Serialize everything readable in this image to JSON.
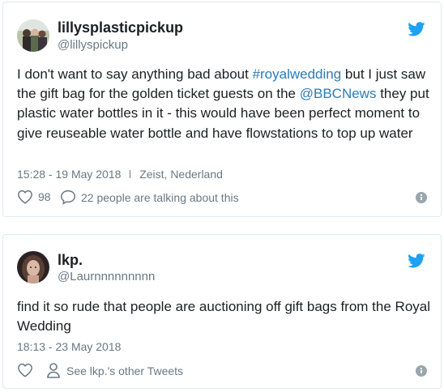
{
  "tweets": [
    {
      "display_name": "lillysplasticpickup",
      "handle": "@lillyspickup",
      "text_parts": [
        {
          "t": "I  don't want to say anything bad about ",
          "link": false
        },
        {
          "t": "#royalwedding",
          "link": true
        },
        {
          "t": " but I just saw the gift bag for the golden ticket guests on the ",
          "link": false
        },
        {
          "t": "@BBCNews",
          "link": true
        },
        {
          "t": "   they put plastic water bottles in it - this would have been perfect moment to give reuseable water bottle and have flowstations to top up water",
          "link": false
        }
      ],
      "timestamp": "15:28 - 19 May 2018",
      "location": "Zeist, Nederland",
      "like_count": "98",
      "talking_label": "22 people are talking about this",
      "icons": [
        "heart-icon",
        "reply-bubble-icon",
        "twitter-bird-icon",
        "info-icon"
      ]
    },
    {
      "display_name": "lkp.",
      "handle": "@Laurnnnnnnnnn",
      "text_parts": [
        {
          "t": "find it so rude that people are auctioning off gift bags from the Royal Wedding",
          "link": false
        }
      ],
      "timestamp": "18:13 - 23 May 2018",
      "other_tweets_label": "See lkp.'s other Tweets",
      "icons": [
        "heart-icon",
        "person-icon",
        "twitter-bird-icon",
        "info-icon"
      ]
    }
  ],
  "colors": {
    "link": "#2b7bb9",
    "twitter_blue": "#1da1f2",
    "muted_text": "#697882",
    "card_border": "#e1e8ed"
  }
}
